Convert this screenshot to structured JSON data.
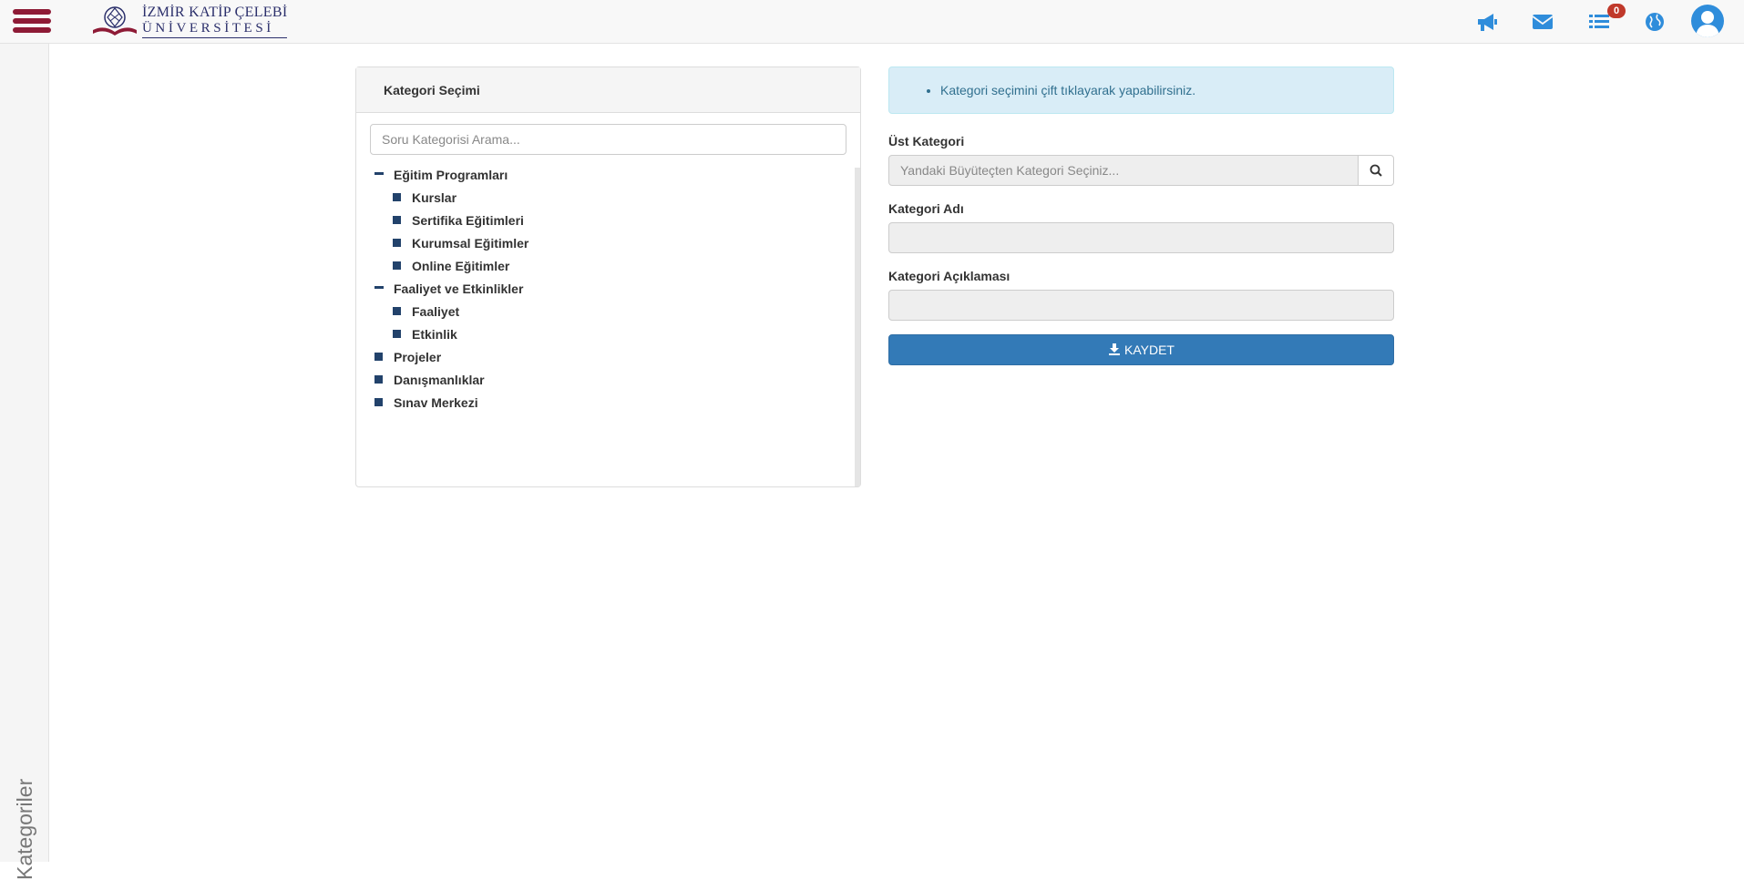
{
  "header": {
    "logo": {
      "line1": "İZMİR KATİP ÇELEBİ",
      "line2": "ÜNİVERSİTESİ"
    },
    "icons": [
      "megaphone-icon",
      "envelope-icon",
      "list-icon",
      "globe-icon",
      "user-icon"
    ],
    "notifications_badge": "0",
    "brand_color": "#8e1b36",
    "icon_color": "#2f8ddb"
  },
  "sidebar": {
    "tab_label": "Kategoriler"
  },
  "category_panel": {
    "title": "Kategori Seçimi",
    "search_placeholder": "Soru Kategorisi Arama...",
    "tree": [
      {
        "label": "Eğitim Programları",
        "expanded": true,
        "children": [
          {
            "label": "Kurslar"
          },
          {
            "label": "Sertifika Eğitimleri"
          },
          {
            "label": "Kurumsal Eğitimler"
          },
          {
            "label": "Online Eğitimler"
          }
        ]
      },
      {
        "label": "Faaliyet ve Etkinlikler",
        "expanded": true,
        "children": [
          {
            "label": "Faaliyet"
          },
          {
            "label": "Etkinlik"
          }
        ]
      },
      {
        "label": "Projeler"
      },
      {
        "label": "Danışmanlıklar"
      },
      {
        "label": "Sınav Merkezi"
      }
    ]
  },
  "form": {
    "info_message": "Kategori seçimini çift tıklayarak yapabilirsiniz.",
    "parent_label": "Üst Kategori",
    "parent_placeholder": "Yandaki Büyüteçten Kategori Seçiniz...",
    "name_label": "Kategori Adı",
    "description_label": "Kategori Açıklaması",
    "save_label": "KAYDET",
    "save_color": "#337ab7",
    "info_color": "#d9edf7"
  }
}
